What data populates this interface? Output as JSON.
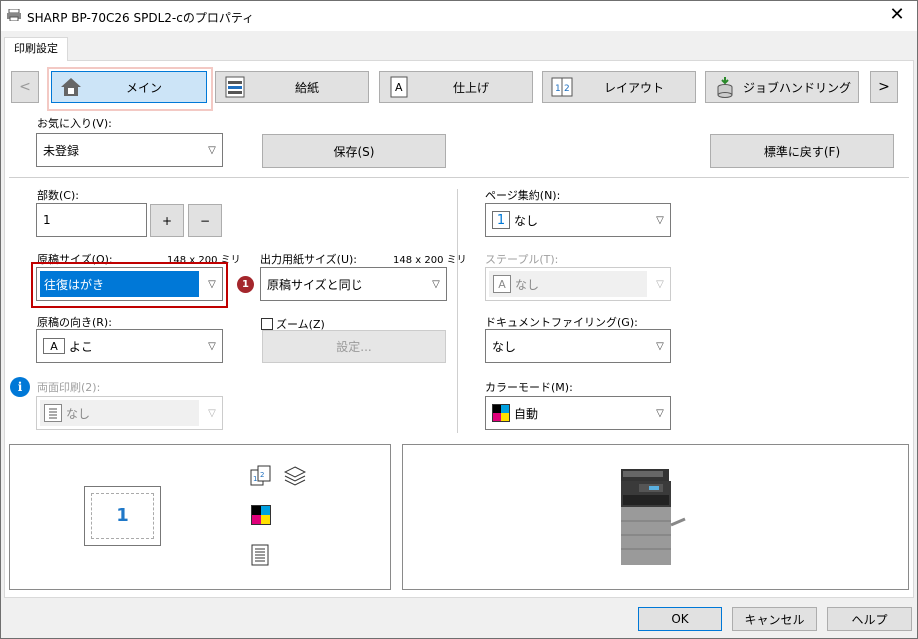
{
  "window": {
    "title": "SHARP BP-70C26 SPDL2-cのプロパティ"
  },
  "tabs": [
    {
      "label": "印刷設定"
    }
  ],
  "nav": {
    "prev": "<",
    "next": ">",
    "items": [
      {
        "label": "メイン",
        "icon": "home-icon"
      },
      {
        "label": "給紙",
        "icon": "paper-tray-icon"
      },
      {
        "label": "仕上げ",
        "icon": "finishing-icon"
      },
      {
        "label": "レイアウト",
        "icon": "layout-icon"
      },
      {
        "label": "ジョブハンドリング",
        "icon": "job-handling-icon"
      }
    ]
  },
  "favorites": {
    "label": "お気に入り(V):",
    "value": "未登録",
    "save": "保存(S)",
    "reset": "標準に戻す(F)"
  },
  "copies": {
    "label": "部数(C):",
    "value": "1",
    "plus": "+",
    "minus": "−"
  },
  "original_size": {
    "label": "原稿サイズ(O):",
    "dims": "148 x 200 ミリ",
    "value": "往復はがき",
    "badge": "1"
  },
  "output_size": {
    "label": "出力用紙サイズ(U):",
    "dims": "148 x 200 ミリ",
    "value": "原稿サイズと同じ"
  },
  "orientation": {
    "label": "原稿の向き(R):",
    "icon_text": "A",
    "value": "よこ"
  },
  "zoom": {
    "label": "ズーム(Z)",
    "settings": "設定..."
  },
  "duplex": {
    "label": "両面印刷(2):",
    "value": "なし"
  },
  "nup": {
    "label": "ページ集約(N):",
    "icon_text": "1",
    "value": "なし"
  },
  "staple": {
    "label": "ステープル(T):",
    "icon_text": "A",
    "value": "なし"
  },
  "doc_filing": {
    "label": "ドキュメントファイリング(G):",
    "value": "なし"
  },
  "color_mode": {
    "label": "カラーモード(M):",
    "value": "自動"
  },
  "preview": {
    "page_number": "1"
  },
  "footer": {
    "ok": "OK",
    "cancel": "キャンセル",
    "help": "ヘルプ"
  },
  "colors": {
    "accent": "#0078d7",
    "highlight_border": "#c00000",
    "badge": "#a4262c"
  }
}
